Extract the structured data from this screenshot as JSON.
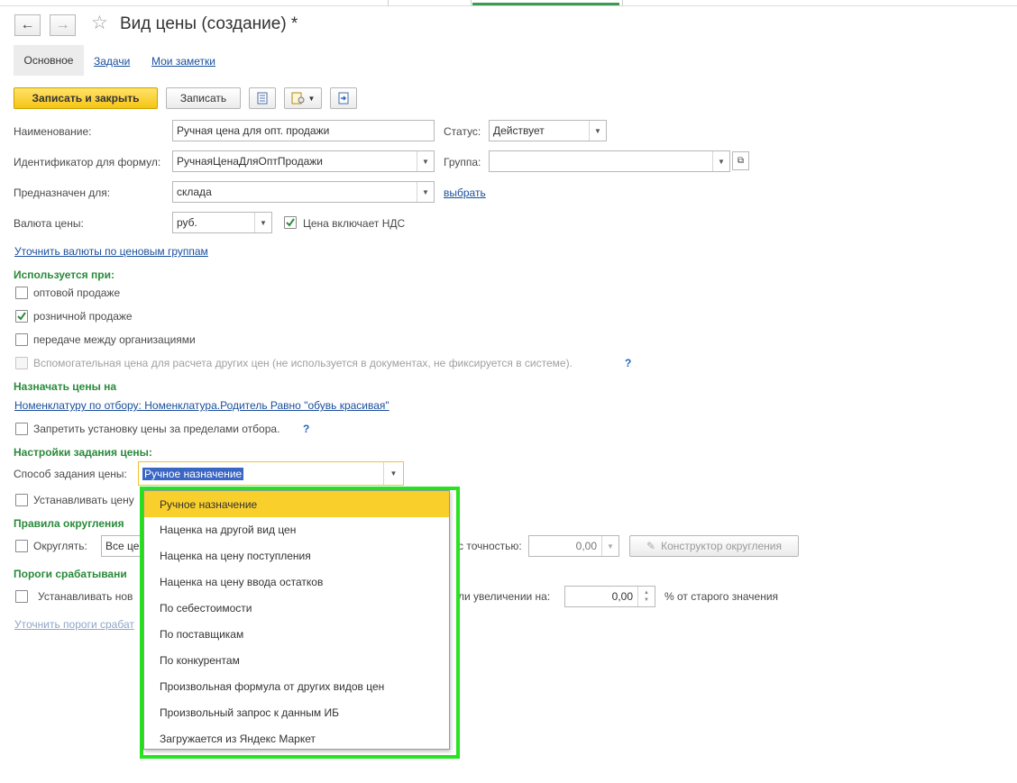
{
  "window": {
    "title": "Вид цены (создание) *"
  },
  "tabs": [
    "Основное",
    "Задачи",
    "Мои заметки"
  ],
  "toolbar": {
    "save_close": "Записать и закрыть",
    "save": "Записать"
  },
  "fields": {
    "name_label": "Наименование:",
    "name_value": "Ручная цена для опт. продажи",
    "status_label": "Статус:",
    "status_value": "Действует",
    "id_label": "Идентификатор для формул:",
    "id_value": "РучнаяЦенаДляОптПродажи",
    "group_label": "Группа:",
    "group_value": "",
    "purpose_label": "Предназначен для:",
    "purpose_value": "склада",
    "purpose_link": "выбрать",
    "currency_label": "Валюта цены:",
    "currency_value": "руб.",
    "vat_label": "Цена включает НДС",
    "currency_link": "Уточнить валюты по ценовым группам"
  },
  "used_in": {
    "header": "Используется при:",
    "items": [
      {
        "label": "оптовой продаже",
        "checked": false
      },
      {
        "label": "розничной продаже",
        "checked": true
      },
      {
        "label": "передаче между организациями",
        "checked": false
      },
      {
        "label": "Вспомогательная цена для расчета других цен (не используется в документах, не фиксируется в системе).",
        "checked": false,
        "disabled": true
      }
    ],
    "help": "?"
  },
  "assign": {
    "header": "Назначать цены на",
    "filter_link": "Номенклатуру по отбору: Номенклатура.Родитель Равно \"обувь красивая\"",
    "forbid_label": "Запретить установку цены за пределами отбора.",
    "help": "?"
  },
  "settings": {
    "header": "Настройки задания цены:",
    "method_label": "Способ задания цены:",
    "method_value": "Ручное назначение",
    "set_price_label": "Устанавливать цену"
  },
  "rounding": {
    "header": "Правила округления",
    "round_label": "Округлять:",
    "round_value": "Все це",
    "precision_label": "с точностью:",
    "precision_value": "0,00",
    "constructor_btn": "Конструктор округления"
  },
  "thresholds": {
    "header": "Пороги срабатывани",
    "set_new_label": "Устанавливать нов",
    "increase_label": "ли увеличении на:",
    "increase_value": "0,00",
    "percent_suffix": "% от старого значения",
    "link": "Уточнить пороги срабат"
  },
  "dropdown": {
    "options": [
      "Ручное назначение",
      "Наценка на другой вид цен",
      "Наценка на цену поступления",
      "Наценка на цену ввода остатков",
      "По себестоимости",
      "По поставщикам",
      "По конкурентам",
      "Произвольная формула от других видов цен",
      "Произвольный запрос к данным ИБ",
      "Загружается из Яндекс Маркет"
    ],
    "selected_index": 0
  },
  "colors": {
    "accent_green": "#2a8a3a",
    "link_blue": "#1a4f9c",
    "highlight_yellow": "#f9cf2b",
    "outline_green": "#27e320"
  }
}
